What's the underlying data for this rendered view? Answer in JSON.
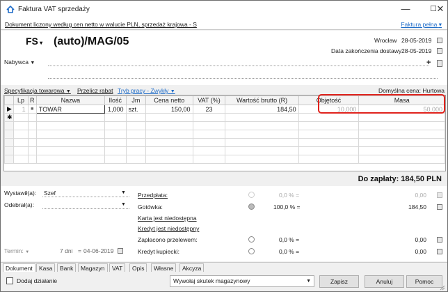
{
  "window": {
    "title": "Faktura VAT sprzedaży",
    "controls": {
      "minimize": "—",
      "maximize": "☐",
      "close": "✕"
    }
  },
  "subheader": {
    "note": "Dokument liczony według cen netto w walucie PLN, sprzedaż krajowa - S",
    "invoice_type": "Faktura pełna"
  },
  "document": {
    "prefix": "FS",
    "number": "(auto)/MAG/05",
    "place": "Wrocław",
    "issue_date": "28-05-2019",
    "delivery_label": "Data zakończenia dostawy",
    "delivery_date": "28-05-2019",
    "buyer_label": "Nabywca",
    "plus": "+"
  },
  "toolbar": {
    "spec": "Specyfikacja towarowa",
    "recalc": "Przelicz rabat",
    "mode": "Tryb pracy - Zwykły",
    "default_price": "Domyślna cena: Hurtowa"
  },
  "grid": {
    "columns": [
      "Lp",
      "R",
      "Nazwa",
      "Ilość",
      "Jm",
      "Cena netto",
      "VAT (%)",
      "Wartość brutto (R)",
      "Objętość",
      "Masa"
    ],
    "rows": [
      {
        "marker": "▶",
        "lp": "1",
        "r": "■",
        "name": "TOWAR",
        "qty": "1,000",
        "unit": "szt.",
        "price": "150,00",
        "vat": "23",
        "gross": "184,50",
        "volume": "10,000",
        "mass": "50,000"
      }
    ],
    "new_row_marker": "✱"
  },
  "total": {
    "text": "Do zapłaty: 184,50 PLN"
  },
  "lower": {
    "issued_by_label": "Wystawił(a):",
    "issued_by_value": "Szef",
    "received_by_label": "Odebrał(a):",
    "received_by_value": "",
    "due_label": "Termin:",
    "due_days": "7 dni",
    "due_eq": "=",
    "due_date": "04-06-2019",
    "payments": [
      {
        "label": "Przedpłata:",
        "percent": "0,0 % =",
        "amount": "0,00",
        "underline": true,
        "selected": false,
        "disabled": true
      },
      {
        "label": "Gotówka:",
        "percent": "100,0 % =",
        "amount": "184,50",
        "underline": false,
        "selected": true,
        "disabled": false
      },
      {
        "label": "Karta jest niedostępna",
        "percent": "",
        "amount": "",
        "underline": true,
        "selected": false,
        "disabled": false
      },
      {
        "label": "Kredyt jest niedostępny",
        "percent": "",
        "amount": "",
        "underline": true,
        "selected": false,
        "disabled": false
      },
      {
        "label": "Zapłacono przelewem:",
        "percent": "0,0 % =",
        "amount": "0,00",
        "underline": false,
        "selected": false,
        "disabled": false
      },
      {
        "label": "Kredyt kupiecki:",
        "percent": "0,0 % =",
        "amount": "0,00",
        "underline": false,
        "selected": false,
        "disabled": false
      }
    ]
  },
  "tabs": [
    "Dokument",
    "Kasa",
    "Bank",
    "Magazyn",
    "VAT",
    "Opis",
    "Własne",
    "Akcyza"
  ],
  "footer": {
    "add_action": "Dodaj działanie",
    "warehouse_effect": "Wywołaj skutek magazynowy",
    "save": "Zapisz",
    "cancel": "Anuluj",
    "help": "Pomoc"
  }
}
